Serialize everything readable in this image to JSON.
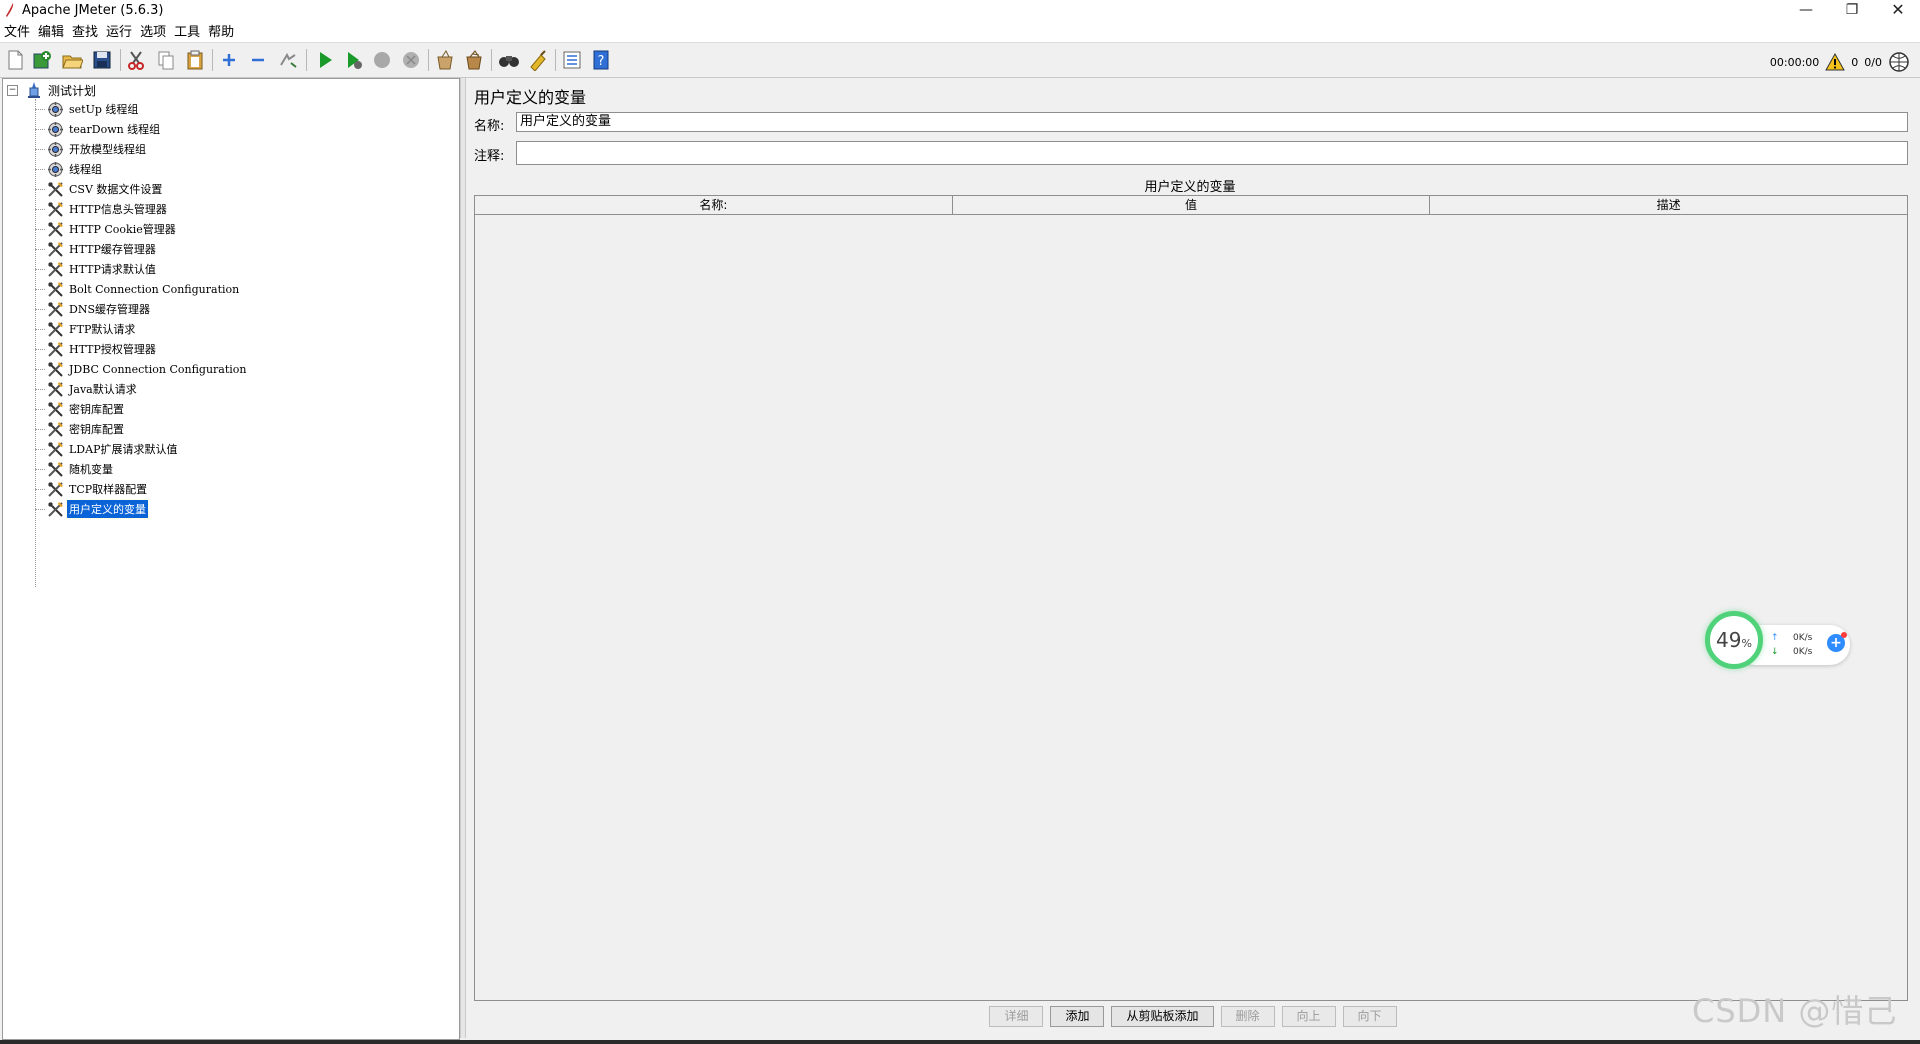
{
  "window": {
    "title": "Apache JMeter (5.6.3)"
  },
  "menu": [
    "文件",
    "编辑",
    "查找",
    "运行",
    "选项",
    "工具",
    "帮助"
  ],
  "status": {
    "timer": "00:00:00",
    "warnings": "0",
    "threads": "0/0"
  },
  "tree": {
    "root": "测试计划",
    "items": [
      {
        "label": "setUp 线程组",
        "icon": "thread-group-icon"
      },
      {
        "label": "tearDown 线程组",
        "icon": "thread-group-icon"
      },
      {
        "label": "开放模型线程组",
        "icon": "thread-group-icon"
      },
      {
        "label": "线程组",
        "icon": "thread-group-icon"
      },
      {
        "label": "CSV 数据文件设置",
        "icon": "config-element-icon"
      },
      {
        "label": "HTTP信息头管理器",
        "icon": "config-element-icon"
      },
      {
        "label": "HTTP Cookie管理器",
        "icon": "config-element-icon"
      },
      {
        "label": "HTTP缓存管理器",
        "icon": "config-element-icon"
      },
      {
        "label": "HTTP请求默认值",
        "icon": "config-element-icon"
      },
      {
        "label": "Bolt Connection Configuration",
        "icon": "config-element-icon"
      },
      {
        "label": "DNS缓存管理器",
        "icon": "config-element-icon"
      },
      {
        "label": "FTP默认请求",
        "icon": "config-element-icon"
      },
      {
        "label": "HTTP授权管理器",
        "icon": "config-element-icon"
      },
      {
        "label": "JDBC Connection Configuration",
        "icon": "config-element-icon"
      },
      {
        "label": "Java默认请求",
        "icon": "config-element-icon"
      },
      {
        "label": "密钥库配置",
        "icon": "config-element-icon"
      },
      {
        "label": "密钥库配置",
        "icon": "config-element-icon"
      },
      {
        "label": "LDAP扩展请求默认值",
        "icon": "config-element-icon"
      },
      {
        "label": "随机变量",
        "icon": "config-element-icon"
      },
      {
        "label": "TCP取样器配置",
        "icon": "config-element-icon"
      },
      {
        "label": "用户定义的变量",
        "icon": "config-element-icon",
        "selected": true
      }
    ]
  },
  "editor": {
    "title": "用户定义的变量",
    "name_label": "名称:",
    "name_value": "用户定义的变量",
    "comment_label": "注释:",
    "comment_value": "",
    "table_caption": "用户定义的变量",
    "columns": [
      "名称:",
      "值",
      "描述"
    ],
    "buttons": [
      {
        "label": "详细",
        "enabled": false
      },
      {
        "label": "添加",
        "enabled": true
      },
      {
        "label": "从剪贴板添加",
        "enabled": true
      },
      {
        "label": "删除",
        "enabled": false
      },
      {
        "label": "向上",
        "enabled": false
      },
      {
        "label": "向下",
        "enabled": false
      }
    ]
  },
  "speed_widget": {
    "percent": "49",
    "percent_sign": "%",
    "upload": "0K/s",
    "download": "0K/s",
    "up_arrow": "↑",
    "down_arrow": "↓",
    "plus": "+"
  },
  "watermark": "CSDN @惜己",
  "colors": {
    "selection": "#0a64d8",
    "run_green": "#1a9a2a",
    "speed_ring": "#4fd27a"
  }
}
